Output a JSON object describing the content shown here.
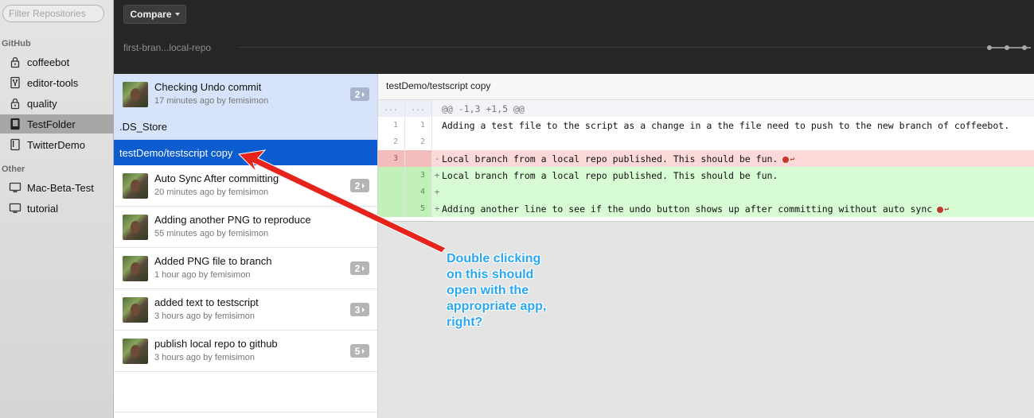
{
  "sidebar": {
    "filter_placeholder": "Filter Repositories",
    "github_section": "GitHub",
    "github_repos": [
      {
        "name": "coffeebot",
        "icon": "lock-icon"
      },
      {
        "name": "editor-tools",
        "icon": "repo-forked-icon"
      },
      {
        "name": "quality",
        "icon": "lock-icon"
      },
      {
        "name": "TestFolder",
        "icon": "repo-book-icon"
      },
      {
        "name": "TwitterDemo",
        "icon": "repo-book-icon"
      }
    ],
    "other_section": "Other",
    "other_repos": [
      {
        "name": "Mac-Beta-Test",
        "icon": "computer-icon"
      },
      {
        "name": "tutorial",
        "icon": "computer-icon"
      }
    ],
    "selected": "TestFolder"
  },
  "toolbar": {
    "compare_label": "Compare",
    "branch_label": "first-bran...local-repo"
  },
  "commits": [
    {
      "title": "Checking Undo commit",
      "meta": "17 minutes ago by femisimon",
      "files": "2"
    },
    {
      "title": "Auto Sync After committing",
      "meta": "20 minutes ago by femisimon",
      "files": "2"
    },
    {
      "title": "Adding another PNG to reproduce",
      "meta": "55 minutes ago by femisimon",
      "files": ""
    },
    {
      "title": "Added PNG file to branch",
      "meta": "1 hour ago by femisimon",
      "files": "2"
    },
    {
      "title": "added text to testscript",
      "meta": "3 hours ago by femisimon",
      "files": "3"
    },
    {
      "title": "publish local repo to github",
      "meta": "3 hours ago by femisimon",
      "files": "5"
    }
  ],
  "changed_files": [
    {
      "name": ".DS_Store",
      "selected": false
    },
    {
      "name": "testDemo/testscript copy",
      "selected": true
    }
  ],
  "diff": {
    "file_title": "testDemo/testscript copy",
    "hunk_header": "@@ -1,3 +1,5 @@",
    "lines": [
      {
        "type": "context",
        "old": "1",
        "new": "1",
        "sign": "",
        "text": "Adding a test file to the script as a change in a the file need to push to the new branch of coffeebot."
      },
      {
        "type": "context",
        "old": "2",
        "new": "2",
        "sign": "",
        "text": ""
      },
      {
        "type": "del",
        "old": "3",
        "new": "",
        "sign": "-",
        "text": "Local branch from a local repo published. This should be fun."
      },
      {
        "type": "add",
        "old": "",
        "new": "3",
        "sign": "+",
        "text": "Local branch from a local repo published. This should be fun."
      },
      {
        "type": "add",
        "old": "",
        "new": "4",
        "sign": "+",
        "text": ""
      },
      {
        "type": "add",
        "old": "",
        "new": "5",
        "sign": "+",
        "text": "Adding another line to see if the undo button shows up after committing without auto sync"
      }
    ],
    "ellipsis": "..."
  },
  "annotation": {
    "text": "Double clicking\non this should\nopen with the\nappropriate app,\nright?",
    "color": "#29a7f2",
    "arrow_color": "#e8231c"
  }
}
